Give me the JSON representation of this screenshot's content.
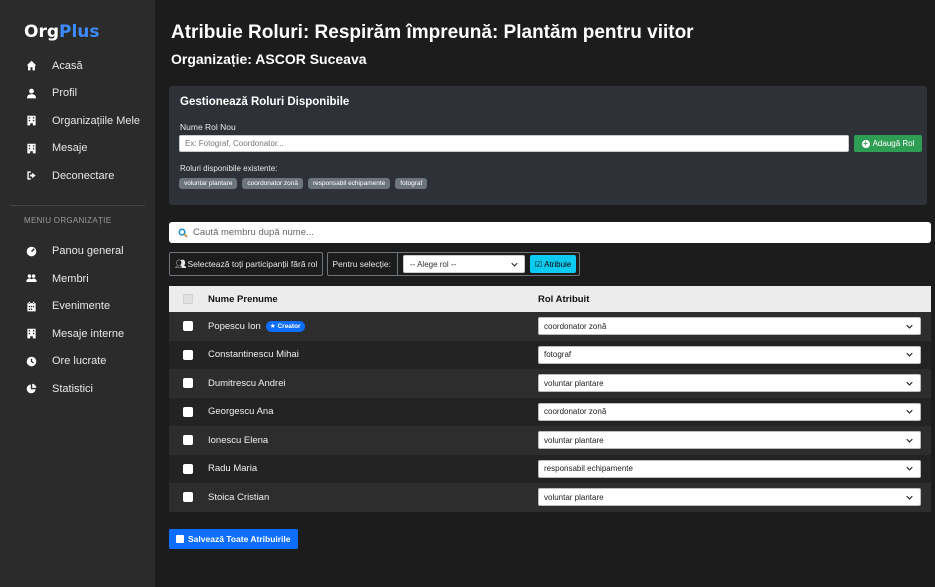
{
  "brand": {
    "name_part1": "Org",
    "name_part2": "Plus"
  },
  "sidebar": {
    "items": [
      {
        "label": "Acasă",
        "icon": "home-icon"
      },
      {
        "label": "Profil",
        "icon": "user-icon"
      },
      {
        "label": "Organizațiile Mele",
        "icon": "building-icon"
      },
      {
        "label": "Mesaje",
        "icon": "building-icon"
      },
      {
        "label": "Deconectare",
        "icon": "logout-icon"
      }
    ],
    "section_title": "MENIU ORGANIZAȚIE",
    "org_items": [
      {
        "label": "Panou general",
        "icon": "dashboard-icon"
      },
      {
        "label": "Membri",
        "icon": "users-icon"
      },
      {
        "label": "Evenimente",
        "icon": "calendar-icon"
      },
      {
        "label": "Mesaje interne",
        "icon": "building-icon"
      },
      {
        "label": "Ore lucrate",
        "icon": "clock-icon"
      },
      {
        "label": "Statistici",
        "icon": "pie-chart-icon"
      }
    ]
  },
  "page": {
    "title": "Atribuie Roluri: Respirăm împreună: Plantăm pentru viitor",
    "organization": "Organizație: ASCOR Suceava"
  },
  "roles_card": {
    "heading": "Gestionează Roluri Disponibile",
    "new_role_label": "Nume Rol Nou",
    "new_role_placeholder": "Ex: Fotograf, Coordonator...",
    "add_button": "Adaugă Rol",
    "existing_label": "Roluri disponibile existente:",
    "existing_roles": [
      "voluntar plantare",
      "coordonator zonă",
      "responsabil echipamente",
      "fotograf"
    ]
  },
  "search": {
    "placeholder": "Caută membru după nume..."
  },
  "controls": {
    "select_all": "Selectează toți participanții fără rol",
    "for_selection": "Pentru selecție:",
    "role_select_value": "-- Alege rol --",
    "assign_button": "Atribuie"
  },
  "table": {
    "headers": {
      "name": "Nume Prenume",
      "role": "Rol Atribuit"
    },
    "rows": [
      {
        "name": "Popescu Ion",
        "badge": "Creator",
        "role": "coordonator zonă"
      },
      {
        "name": "Constantinescu Mihai",
        "badge": "",
        "role": "fotograf"
      },
      {
        "name": "Dumitrescu Andrei",
        "badge": "",
        "role": "voluntar plantare"
      },
      {
        "name": "Georgescu Ana",
        "badge": "",
        "role": "coordonator zonă"
      },
      {
        "name": "Ionescu Elena",
        "badge": "",
        "role": "voluntar plantare"
      },
      {
        "name": "Radu Maria",
        "badge": "",
        "role": "responsabil echipamente"
      },
      {
        "name": "Stoica Cristian",
        "badge": "",
        "role": "voluntar plantare"
      }
    ]
  },
  "save_button": "Salvează Toate Atribuirile",
  "colors": {
    "accent": "#3d8bfd",
    "primary": "#0d6efd",
    "success": "#2f9e55",
    "info": "#0dcaf0",
    "sidebar": "#2b2b2b"
  }
}
